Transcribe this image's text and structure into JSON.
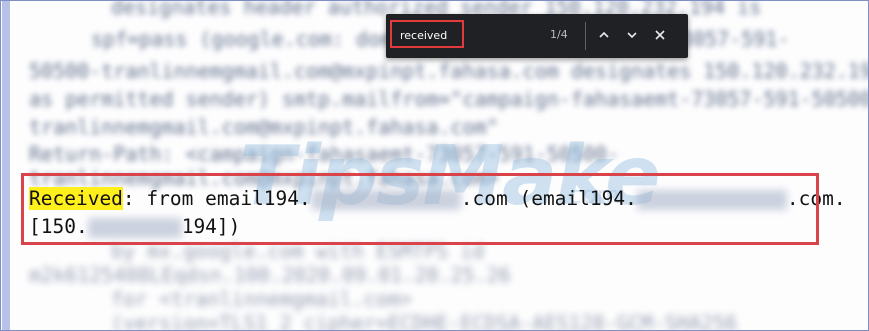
{
  "find_bar": {
    "query": "received",
    "count": "1/4",
    "prev_icon": "chevron-up-icon",
    "next_icon": "chevron-down-icon",
    "close_icon": "close-icon"
  },
  "highlight": {
    "match": "Received",
    "line1_rest": ": from email194.",
    "line1_mid": ".com (email194.",
    "line1_end": ".com.",
    "line2_start": "[150.",
    "line2_end": "194])"
  },
  "watermark": {
    "brand": "TipsMake",
    "suffix": ".com"
  },
  "colors": {
    "highlight_border": "#d9434a",
    "match_fill": "#ffef1a",
    "find_bar_bg": "#202124"
  }
}
